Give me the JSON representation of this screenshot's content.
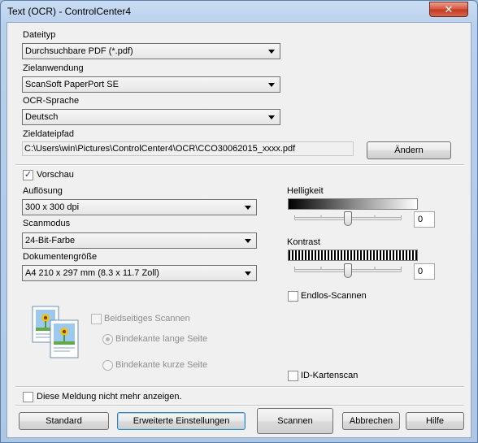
{
  "window": {
    "title": "Text (OCR) - ControlCenter4",
    "close_glyph": "✕"
  },
  "file_type": {
    "label": "Dateityp",
    "value": "Durchsuchbare PDF (*.pdf)"
  },
  "target_app": {
    "label": "Zielanwendung",
    "value": "ScanSoft PaperPort SE"
  },
  "ocr_language": {
    "label": "OCR-Sprache",
    "value": "Deutsch"
  },
  "target_path": {
    "label": "Zieldateipfad",
    "value": "C:\\Users\\win\\Pictures\\ControlCenter4\\OCR\\CCO30062015_xxxx.pdf",
    "change_button": "Ändern"
  },
  "preview": {
    "label": "Vorschau",
    "checked": true
  },
  "resolution": {
    "label": "Auflösung",
    "value": "300 x 300 dpi"
  },
  "scan_mode": {
    "label": "Scanmodus",
    "value": "24-Bit-Farbe"
  },
  "document_size": {
    "label": "Dokumentengröße",
    "value": "A4 210 x 297 mm (8.3 x 11.7 Zoll)"
  },
  "brightness": {
    "label": "Helligkeit",
    "value": "0"
  },
  "contrast": {
    "label": "Kontrast",
    "value": "0"
  },
  "continuous_scan": {
    "label": "Endlos-Scannen",
    "checked": false
  },
  "duplex": {
    "label": "Beidseitiges Scannen",
    "option_long": "Bindekante lange Seite",
    "option_short": "Bindekante kurze Seite"
  },
  "id_card_scan": {
    "label": "ID-Kartenscan",
    "checked": false
  },
  "dont_show": {
    "label": "Diese Meldung nicht mehr anzeigen.",
    "checked": false
  },
  "buttons": {
    "default": "Standard",
    "advanced": "Erweiterte Einstellungen",
    "scan": "Scannen",
    "cancel": "Abbrechen",
    "help": "Hilfe"
  }
}
